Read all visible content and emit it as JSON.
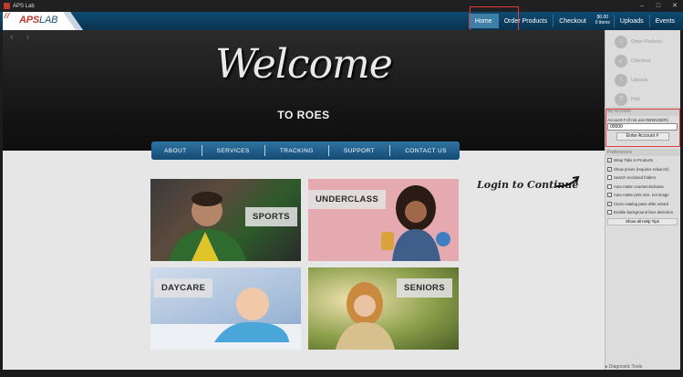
{
  "window": {
    "title": "APS Lab",
    "controls": [
      "–",
      "□",
      "✕"
    ]
  },
  "logo": {
    "brand": "APS",
    "suffix": "LAB"
  },
  "topnav": {
    "home": "Home",
    "order_products": "Order Products",
    "checkout": "Checkout",
    "cart_total": "$0.00",
    "cart_items": "0 items",
    "uploads": "Uploads",
    "events": "Events"
  },
  "hero": {
    "welcome": "Welcome",
    "subtitle": "TO ROES"
  },
  "subnav": [
    "ABOUT",
    "SERVICES",
    "TRACKING",
    "SUPPORT",
    "CONTACT US"
  ],
  "login_hint": "Login to Continue",
  "tiles": {
    "sports": "SPORTS",
    "underclass": "UNDERCLASS",
    "daycare": "DAYCARE",
    "seniors": "SENIORS"
  },
  "panel": {
    "buttons": [
      "Order Products",
      "Checkout",
      "Uploads",
      "Help"
    ],
    "my_account_header": "My Account",
    "account_label": "Account # (if n/a use NEWUSER)",
    "account_value": "00000",
    "enter_button": "Enter Account #",
    "preferences_header": "Preferences",
    "preferences": [
      {
        "label": "Wrap Tabs in Products",
        "checked": true
      },
      {
        "label": "Show prices (requires relaunch)",
        "checked": true
      },
      {
        "label": "Search enclosed folders",
        "checked": false
      },
      {
        "label": "Auto rotate counterclockwise",
        "checked": false
      },
      {
        "label": "Auto rotate print size, not image",
        "checked": true
      },
      {
        "label": "Close catalog pane after wizard",
        "checked": true
      },
      {
        "label": "Enable background face detection",
        "checked": false
      }
    ],
    "help_tips": "Show all Help Tips",
    "diagnostic": "Diagnostic Tools"
  }
}
